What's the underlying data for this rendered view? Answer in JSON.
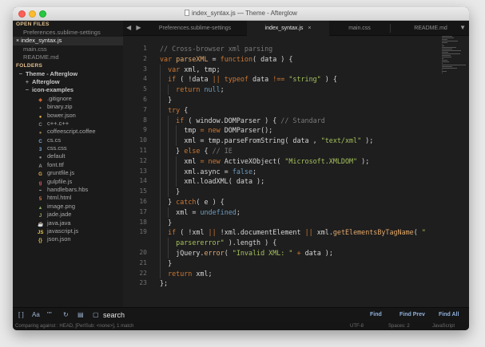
{
  "window": {
    "title": "index_syntax.js — Theme - Afterglow"
  },
  "sidebar": {
    "open_files_heading": "OPEN FILES",
    "open_files": [
      {
        "label": "Preferences.sublime-settings",
        "active": false
      },
      {
        "label": "index_syntax.js",
        "close": "×",
        "active": true
      },
      {
        "label": "main.css",
        "active": false
      },
      {
        "label": "README.md",
        "active": false
      }
    ],
    "folders_heading": "FOLDERS",
    "folders": [
      {
        "label": "Theme - Afterglow",
        "arrow": "−",
        "indent": 1
      },
      {
        "label": "Afterglow",
        "arrow": "+",
        "indent": 2
      },
      {
        "label": "icon-examples",
        "arrow": "−",
        "indent": 2
      }
    ],
    "files": [
      {
        "label": ".gitignore",
        "icon": "gitignore-icon",
        "glyph": "◆",
        "color": "#c0662f"
      },
      {
        "label": "binary.zip",
        "icon": "zip-icon",
        "glyph": "▪",
        "color": "#9a9a9a"
      },
      {
        "label": "bower.json",
        "icon": "bower-icon",
        "glyph": "●",
        "color": "#e7b14f"
      },
      {
        "label": "c++.c++",
        "icon": "cpp-icon",
        "glyph": "C",
        "color": "#8a8a8a"
      },
      {
        "label": "coffeescript.coffee",
        "icon": "coffee-icon",
        "glyph": "●",
        "color": "#9a7b4f"
      },
      {
        "label": "cs.cs",
        "icon": "csharp-icon",
        "glyph": "C",
        "color": "#7aa6da"
      },
      {
        "label": "css.css",
        "icon": "css-icon",
        "glyph": "3",
        "color": "#7aa6da"
      },
      {
        "label": "default",
        "icon": "default-file-icon",
        "glyph": "●",
        "color": "#8a8a8a"
      },
      {
        "label": "font.ttf",
        "icon": "font-icon",
        "glyph": "A",
        "color": "#9a9a9a"
      },
      {
        "label": "gruntfile.js",
        "icon": "grunt-icon",
        "glyph": "G",
        "color": "#e7b14f"
      },
      {
        "label": "gulpfile.js",
        "icon": "gulp-icon",
        "glyph": "g",
        "color": "#d45b5b"
      },
      {
        "label": "handlebars.hbs",
        "icon": "handlebars-icon",
        "glyph": "~",
        "color": "#c9c9c9"
      },
      {
        "label": "html.html",
        "icon": "html-icon",
        "glyph": "5",
        "color": "#e07a4a"
      },
      {
        "label": "image.png",
        "icon": "image-icon",
        "glyph": "▲",
        "color": "#7faa5f"
      },
      {
        "label": "jade.jade",
        "icon": "jade-icon",
        "glyph": "J",
        "color": "#9ab06a"
      },
      {
        "label": "java.java",
        "icon": "java-icon",
        "glyph": "☕",
        "color": "#d07a4a"
      },
      {
        "label": "javascript.js",
        "icon": "javascript-icon",
        "glyph": "JS",
        "color": "#e7c84f"
      },
      {
        "label": "json.json",
        "icon": "json-icon",
        "glyph": "{}",
        "color": "#e7c84f"
      }
    ]
  },
  "tabs": {
    "nav": "◀ ▶",
    "items": [
      {
        "label": "Preferences.sublime-settings",
        "active": false
      },
      {
        "label": "index_syntax.js",
        "close": "×",
        "active": true
      },
      {
        "label": "main.css",
        "active": false
      },
      {
        "label": "README.md",
        "active": false
      }
    ],
    "dropdown": "▼"
  },
  "editor": {
    "line_numbers": [
      "1",
      "2",
      "3",
      "4",
      "5",
      "6",
      "7",
      "8",
      "9",
      "10",
      "11",
      "12",
      "13",
      "14",
      "15",
      "16",
      "17",
      "18",
      "19",
      "20",
      "21",
      "22",
      "23"
    ],
    "lines": [
      [
        [
          "cmt",
          "// Cross-browser xml parsing"
        ]
      ],
      [
        [
          "kw",
          "var "
        ],
        [
          "fn",
          "parseXML"
        ],
        [
          "punc",
          " = "
        ],
        [
          "kw",
          "function"
        ],
        [
          "punc",
          "( data ) {"
        ]
      ],
      [
        [
          "sp",
          "  "
        ],
        [
          "kw",
          "var "
        ],
        [
          "var",
          "xml, tmp;"
        ]
      ],
      [
        [
          "sp",
          "  "
        ],
        [
          "kw",
          "if "
        ],
        [
          "punc",
          "( !data "
        ],
        [
          "kw",
          "|| typeof "
        ],
        [
          "var",
          "data "
        ],
        [
          "kw",
          "!== "
        ],
        [
          "str",
          "\"string\""
        ],
        [
          "punc",
          " ) {"
        ]
      ],
      [
        [
          "sp",
          "    "
        ],
        [
          "kw",
          "return "
        ],
        [
          "con",
          "null"
        ],
        [
          "punc",
          ";"
        ]
      ],
      [
        [
          "sp",
          "  "
        ],
        [
          "punc",
          "}"
        ]
      ],
      [
        [
          "sp",
          "  "
        ],
        [
          "kw",
          "try "
        ],
        [
          "punc",
          "{"
        ]
      ],
      [
        [
          "sp",
          "    "
        ],
        [
          "kw",
          "if "
        ],
        [
          "punc",
          "( window.DOMParser ) { "
        ],
        [
          "cmt",
          "// Standard"
        ]
      ],
      [
        [
          "sp",
          "      "
        ],
        [
          "var",
          "tmp "
        ],
        [
          "kw",
          "= new "
        ],
        [
          "var",
          "DOMParser();"
        ]
      ],
      [
        [
          "sp",
          "      "
        ],
        [
          "var",
          "xml = tmp.parseFromString( data , "
        ],
        [
          "str",
          "\"text/xml\""
        ],
        [
          "punc",
          " );"
        ]
      ],
      [
        [
          "sp",
          "    "
        ],
        [
          "punc",
          "} "
        ],
        [
          "kw",
          "else "
        ],
        [
          "punc",
          "{ "
        ],
        [
          "cmt",
          "// IE"
        ]
      ],
      [
        [
          "sp",
          "      "
        ],
        [
          "var",
          "xml "
        ],
        [
          "kw",
          "= new "
        ],
        [
          "var",
          "ActiveXObject( "
        ],
        [
          "str",
          "\"Microsoft.XMLDOM\""
        ],
        [
          "punc",
          " );"
        ]
      ],
      [
        [
          "sp",
          "      "
        ],
        [
          "var",
          "xml.async = "
        ],
        [
          "con",
          "false"
        ],
        [
          "punc",
          ";"
        ]
      ],
      [
        [
          "sp",
          "      "
        ],
        [
          "var",
          "xml.loadXML( data );"
        ]
      ],
      [
        [
          "sp",
          "    "
        ],
        [
          "punc",
          "}"
        ]
      ],
      [
        [
          "sp",
          "  "
        ],
        [
          "punc",
          "} "
        ],
        [
          "kw",
          "catch"
        ],
        [
          "punc",
          "( e ) {"
        ]
      ],
      [
        [
          "sp",
          "    "
        ],
        [
          "var",
          "xml = "
        ],
        [
          "con",
          "undefined"
        ],
        [
          "punc",
          ";"
        ]
      ],
      [
        [
          "sp",
          "  "
        ],
        [
          "punc",
          "}"
        ]
      ],
      [
        [
          "sp",
          "  "
        ],
        [
          "kw",
          "if "
        ],
        [
          "punc",
          "( !xml "
        ],
        [
          "kw",
          "|| "
        ],
        [
          "punc",
          "!xml.documentElement "
        ],
        [
          "kw",
          "|| "
        ],
        [
          "var",
          "xml."
        ],
        [
          "fn",
          "getElementsByTagName"
        ],
        [
          "punc",
          "( "
        ],
        [
          "str",
          "\""
        ]
      ],
      [
        [
          "sp",
          "    "
        ],
        [
          "str",
          "parsererror"
        ],
        [
          "str",
          "\""
        ],
        [
          "punc",
          " ).length ) {"
        ]
      ],
      [
        [
          "sp",
          "    "
        ],
        [
          "var",
          "jQuery."
        ],
        [
          "fn",
          "error"
        ],
        [
          "punc",
          "( "
        ],
        [
          "str",
          "\"Invalid XML: \""
        ],
        [
          "kw",
          " + "
        ],
        [
          "var",
          "data );"
        ]
      ],
      [
        [
          "sp",
          "  "
        ],
        [
          "punc",
          "}"
        ]
      ],
      [
        [
          "sp",
          "  "
        ],
        [
          "kw",
          "return "
        ],
        [
          "var",
          "xml;"
        ]
      ],
      [
        [
          "punc",
          "};"
        ]
      ]
    ]
  },
  "findbar": {
    "options": [
      {
        "name": "regex-toggle",
        "glyph": "[ ]"
      },
      {
        "name": "case-sensitive-toggle",
        "glyph": "Aa"
      },
      {
        "name": "whole-word-toggle",
        "glyph": "\"\""
      },
      {
        "name": "wrap-toggle",
        "glyph": "↻"
      },
      {
        "name": "in-selection-toggle",
        "glyph": "▤"
      },
      {
        "name": "highlight-toggle",
        "glyph": "▢"
      }
    ],
    "query": "search",
    "find_label": "Find",
    "find_prev_label": "Find Prev",
    "find_all_label": "Find All"
  },
  "statusbar": {
    "left": "Comparing against : HEAD, [PerlSub: <none>], 1 match",
    "encoding": "UTF-8",
    "indentation": "Spaces: 2",
    "syntax": "JavaScript"
  }
}
